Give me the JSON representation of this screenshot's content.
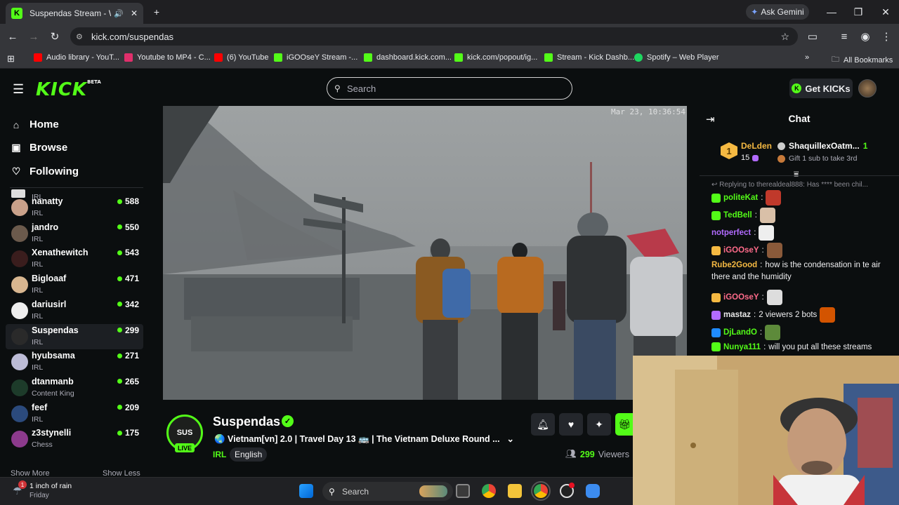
{
  "browser": {
    "tab_title": "Suspendas Stream - Watch",
    "url": "kick.com/suspendas",
    "ask_gemini": "Ask Gemini",
    "bookmarks": [
      "Audio library - YouT...",
      "Youtube to MP4 - C...",
      "(6) YouTube",
      "iGOOseY Stream -...",
      "dashboard.kick.com...",
      "kick.com/popout/ig...",
      "Stream - Kick Dashb...",
      "Spotify – Web Player"
    ],
    "all_bookmarks": "All Bookmarks"
  },
  "kick": {
    "logo": "KICK",
    "logo_badge": "BETA",
    "search_placeholder": "Search",
    "get_kicks": "Get KICKs"
  },
  "sidebar": {
    "nav": [
      {
        "label": "Home",
        "icon": "home-icon"
      },
      {
        "label": "Browse",
        "icon": "browse-icon"
      },
      {
        "label": "Following",
        "icon": "heart-icon"
      }
    ],
    "top_partial_category": "IRL",
    "channels": [
      {
        "name": "nanatty",
        "category": "IRL",
        "viewers": "588",
        "color": "#c9a18a"
      },
      {
        "name": "jandro",
        "category": "IRL",
        "viewers": "550",
        "color": "#6b5a4c"
      },
      {
        "name": "Xenathewitch",
        "category": "IRL",
        "viewers": "543",
        "color": "#3a1d1d"
      },
      {
        "name": "Bigloaaf",
        "category": "IRL",
        "viewers": "471",
        "color": "#d8b690"
      },
      {
        "name": "dariusirl",
        "category": "IRL",
        "viewers": "342",
        "color": "#eeeeee"
      },
      {
        "name": "Suspendas",
        "category": "IRL",
        "viewers": "299",
        "color": "#2a2a2a"
      },
      {
        "name": "hyubsama",
        "category": "IRL",
        "viewers": "271",
        "color": "#bcbcd6"
      },
      {
        "name": "dtanmanb",
        "category": "Content King",
        "viewers": "265",
        "color": "#1d3b2a"
      },
      {
        "name": "feef",
        "category": "IRL",
        "viewers": "209",
        "color": "#2b4a7c"
      },
      {
        "name": "z3stynelli",
        "category": "Chess",
        "viewers": "175",
        "color": "#8c3a8c"
      }
    ],
    "show_more": "Show More",
    "show_less": "Show Less"
  },
  "video": {
    "timestamp": "Mar 23, 10:36:54"
  },
  "stream": {
    "avatar_text": "SUS",
    "live": "LIVE",
    "name": "Suspendas",
    "title": "🌏 Vietnam[vn] 2.0 | Travel Day 13 🚌 | The Vietnam Deluxe Round ...",
    "category": "IRL",
    "language": "English",
    "viewers_count": "299",
    "viewers_label": "Viewers"
  },
  "chat": {
    "title": "Chat",
    "leaderboard": {
      "first_name": "DeLden",
      "first_rank": "1",
      "first_count": "15",
      "second_name": "ShaquillexOatm...",
      "second_count": "1",
      "gift_text": "Gift 1 sub to take 3rd"
    },
    "reply_text": "Replying to therealdeal888: Has **** been chil...",
    "messages": [
      {
        "user": "politeKat",
        "text": "",
        "color": "#53fc18"
      },
      {
        "user": "TedBell",
        "text": "",
        "color": "#53fc18"
      },
      {
        "user": "notperfect",
        "text": "",
        "color": "#b26bff"
      },
      {
        "user": "iGOOseY",
        "text": "",
        "color": "#ff6b8a"
      },
      {
        "user": "Rube2Good",
        "text": "how is the condensation in te air",
        "text2": "there and the humidity",
        "color": "#f5b942"
      },
      {
        "user": "iGOOseY",
        "text": "",
        "color": "#ff6b8a"
      },
      {
        "user": "mastaz",
        "text": "2 viewers 2 bots",
        "color": "#e8e8e8"
      },
      {
        "user": "DjLandO",
        "text": "",
        "color": "#53fc18"
      },
      {
        "user": "Nunya111",
        "text": "will you put all these streams",
        "color": "#53fc18"
      }
    ]
  },
  "taskbar": {
    "weather_title": "1 inch of rain",
    "weather_day": "Friday",
    "weather_badge": "1",
    "search": "Search"
  }
}
